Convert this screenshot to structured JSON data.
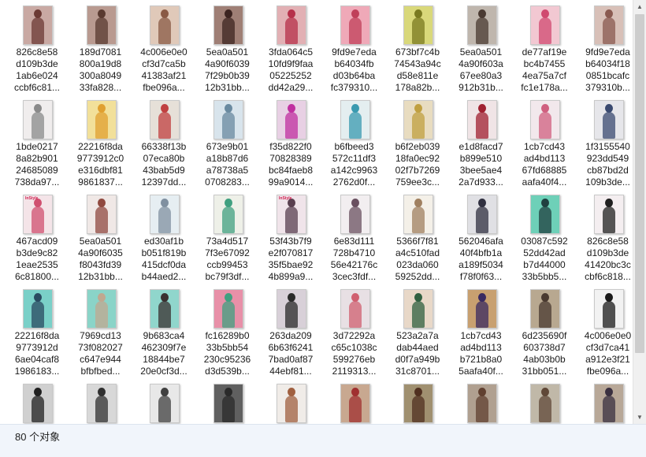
{
  "window": {
    "status_text": "80 个对象"
  },
  "files": [
    {
      "name": "826c8e58\nd109b3de\n1ab6e024\nccbf6c81...",
      "thumb": "#c9a9a3",
      "accent": "#6b3a34",
      "tag": ""
    },
    {
      "name": "189d7081\n800a19d8\n300a8049\n33fa828...",
      "thumb": "#b99a90",
      "accent": "#5a3a30",
      "tag": ""
    },
    {
      "name": "4c006e0e0\ncf3d7ca5b\n41383af21\nfbe096a...",
      "thumb": "#e0c9b9",
      "accent": "#8a5a45",
      "tag": ""
    },
    {
      "name": "5ea0a501\n4a90f6039\n7f29b0b39\n12b31bb...",
      "thumb": "#9f7f75",
      "accent": "#3c2420",
      "tag": ""
    },
    {
      "name": "3fda064c5\n10fd9f9faa\n05225252\ndd42a29...",
      "thumb": "#e2b0b4",
      "accent": "#b6304a",
      "tag": ""
    },
    {
      "name": "9fd9e7eda\nb64034fb\nd03b64ba\nfc379310...",
      "thumb": "#efa9b8",
      "accent": "#c0405a",
      "tag": ""
    },
    {
      "name": "673bf7c4b\n74543a94c\nd58e811e\n178a82b...",
      "thumb": "#d9d87a",
      "accent": "#7a7a20",
      "tag": ""
    },
    {
      "name": "5ea0a501\n4a90f603a\n67ee80a3\n912b31b...",
      "thumb": "#bfb6ad",
      "accent": "#4a3a32",
      "tag": ""
    },
    {
      "name": "de77af19e\nbc4b7455\n4ea75a7cf\nfc1e178a...",
      "thumb": "#f2c8d2",
      "accent": "#d04a70",
      "tag": ""
    },
    {
      "name": "9fd9e7eda\nb64034f18\n0851bcafc\n379310b...",
      "thumb": "#d8c0b8",
      "accent": "#8a5a50",
      "tag": ""
    },
    {
      "name": "1bde0217\n8a82b901\n24685089\n738da97...",
      "thumb": "#f0eded",
      "accent": "#8a8a8a",
      "tag": ""
    },
    {
      "name": "22216f8da\n9773912c0\ne316dbf81\n9861837...",
      "thumb": "#f2e09a",
      "accent": "#e0a030",
      "tag": ""
    },
    {
      "name": "66338f13b\n07eca80b\n43bab5d9\n12397dd...",
      "thumb": "#e6e0d8",
      "accent": "#c04040",
      "tag": ""
    },
    {
      "name": "673e9b01\na18b87d6\na78738a5\n0708283...",
      "thumb": "#d8e4ec",
      "accent": "#6a8aa0",
      "tag": ""
    },
    {
      "name": "f35d822f0\n70828389\nbc84faeb8\n99a9014...",
      "thumb": "#e8d0e4",
      "accent": "#c030a0",
      "tag": ""
    },
    {
      "name": "b6fbeed3\n572c11df3\na142c9963\n2762d0f...",
      "thumb": "#e4eef0",
      "accent": "#3a9ab0",
      "tag": ""
    },
    {
      "name": "b6f2eb039\n18fa0ec92\n02f7b7269\n759ee3c...",
      "thumb": "#e8dcc0",
      "accent": "#c0a040",
      "tag": ""
    },
    {
      "name": "e1d8facd7\nb899e510\n3bee5ae4\n2a7d933...",
      "thumb": "#f0e4e6",
      "accent": "#a02030",
      "tag": ""
    },
    {
      "name": "1cb7cd43\nad4bd113\n67fd68885\naafa40f4...",
      "thumb": "#f2e8ec",
      "accent": "#d06080",
      "tag": ""
    },
    {
      "name": "1f3155540\n923dd549\ncb87bd2d\n109b3de...",
      "thumb": "#e6e6ea",
      "accent": "#3a4a70",
      "tag": ""
    },
    {
      "name": "467acd09\nb3de9c82\n1eae2535\n6c81800...",
      "thumb": "#f4e4e8",
      "accent": "#d05070",
      "tag": "InStyle"
    },
    {
      "name": "5ea0a501\n4a90f6035\nf8043fd39\n12b31bb...",
      "thumb": "#f0e8e6",
      "accent": "#904a40",
      "tag": ""
    },
    {
      "name": "ed30af1b\nb051f819b\n415dcf0da\nb44aed2...",
      "thumb": "#e6eef2",
      "accent": "#8090a0",
      "tag": ""
    },
    {
      "name": "73a4d517\n7f3e67092\nccb99453\nbc79f3df...",
      "thumb": "#eef0e8",
      "accent": "#40a080",
      "tag": ""
    },
    {
      "name": "53f43b7f9\ne2f070817\n35f5bae92\n4b899a9...",
      "thumb": "#f0e4ea",
      "accent": "#5a4050",
      "tag": "InStyle"
    },
    {
      "name": "6e83d111\n728b4710\n56e42176c\n3cec3fdf...",
      "thumb": "#f2eef0",
      "accent": "#6a5060",
      "tag": ""
    },
    {
      "name": "5366f7f81\na4c510fad\n023da060\n59252dd...",
      "thumb": "#f4f0e8",
      "accent": "#a08060",
      "tag": ""
    },
    {
      "name": "562046afa\n40f4bfb1a\na189f5034\nf78f0f63...",
      "thumb": "#e0e0e4",
      "accent": "#303040",
      "tag": ""
    },
    {
      "name": "03087c592\n52dd42ad\nb7d44000\n33b5bb5...",
      "thumb": "#6ed0b8",
      "accent": "#204040",
      "tag": ""
    },
    {
      "name": "826c8e58\nd109b3de\n41420bc3c\ncbf6c818...",
      "thumb": "#f4eef0",
      "accent": "#202020",
      "tag": ""
    },
    {
      "name": "22216f8da\n9773912d\n6ae04caf8\n1986183...",
      "thumb": "#7ad0c8",
      "accent": "#2a4a60",
      "tag": ""
    },
    {
      "name": "7969cd13\n73f082027\nc647e944\nbfbfbed...",
      "thumb": "#8ad4c8",
      "accent": "#c0a890",
      "tag": ""
    },
    {
      "name": "9b683ca4\n462309f7e\n18844be7\n20e0cf3d...",
      "thumb": "#90d6cc",
      "accent": "#3a3030",
      "tag": ""
    },
    {
      "name": "fc16289b0\n33b5bb54\n230c95236\nd3d539b...",
      "thumb": "#e890a8",
      "accent": "#40a080",
      "tag": ""
    },
    {
      "name": "263da209\n6b63f6241\n7bad0af87\n44ebf81...",
      "thumb": "#d8d0d8",
      "accent": "#2a2a2a",
      "tag": ""
    },
    {
      "name": "3d72292a\nc65c1038c\n599276eb\n2119313...",
      "thumb": "#e8e0e4",
      "accent": "#d06070",
      "tag": ""
    },
    {
      "name": "523a2a7a\ndab44aed\nd0f7a949b\n31c8701...",
      "thumb": "#e8d8c8",
      "accent": "#306040",
      "tag": ""
    },
    {
      "name": "1cb7cd43\nad4bd113\nb721b8a0\n5aafa40f...",
      "thumb": "#c8a070",
      "accent": "#3a2a60",
      "tag": ""
    },
    {
      "name": "6d235690f\n603738d7\n4ab03b0b\n31bb051...",
      "thumb": "#b8a890",
      "accent": "#4a3a30",
      "tag": ""
    },
    {
      "name": "4c006e0e0\ncf3d7ca41\na912e3f21\nfbe096a...",
      "thumb": "#f2f2f2",
      "accent": "#1a1a1a",
      "tag": ""
    },
    {
      "name": "",
      "thumb": "#d0d0d0",
      "accent": "#202020",
      "tag": ""
    },
    {
      "name": "",
      "thumb": "#d8d8d8",
      "accent": "#303030",
      "tag": ""
    },
    {
      "name": "",
      "thumb": "#e8e8e8",
      "accent": "#404040",
      "tag": ""
    },
    {
      "name": "",
      "thumb": "#606060",
      "accent": "#2a2a2a",
      "tag": ""
    },
    {
      "name": "",
      "thumb": "#f0ece8",
      "accent": "#a06040",
      "tag": ""
    },
    {
      "name": "",
      "thumb": "#c8a890",
      "accent": "#a03030",
      "tag": ""
    },
    {
      "name": "",
      "thumb": "#a09070",
      "accent": "#503020",
      "tag": ""
    },
    {
      "name": "",
      "thumb": "#b0a090",
      "accent": "#604030",
      "tag": ""
    },
    {
      "name": "",
      "thumb": "#c0b8a8",
      "accent": "#604838",
      "tag": ""
    },
    {
      "name": "",
      "thumb": "#b8a898",
      "accent": "#3a3040",
      "tag": ""
    }
  ]
}
